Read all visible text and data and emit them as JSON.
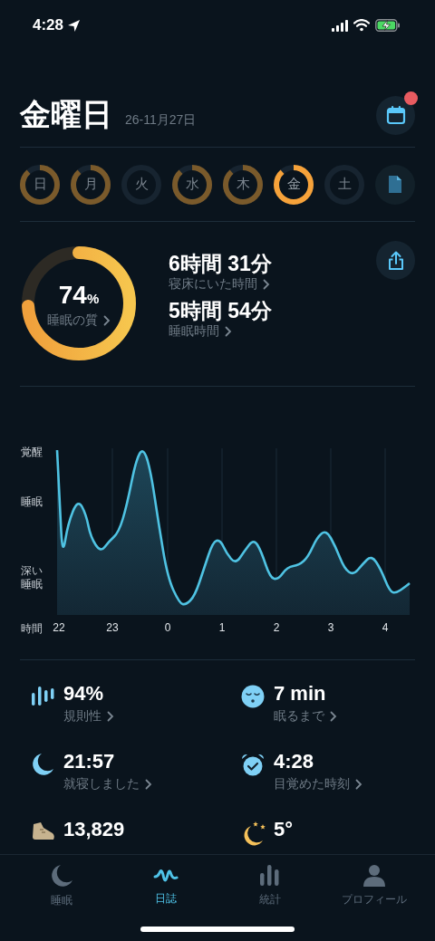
{
  "status_bar": {
    "time": "4:28"
  },
  "header": {
    "title": "金曜日",
    "date": "26-11月27日",
    "calendar_notification": true
  },
  "days": [
    {
      "label": "日",
      "kind": "recorded",
      "selected": false
    },
    {
      "label": "月",
      "kind": "recorded",
      "selected": false
    },
    {
      "label": "火",
      "kind": "empty",
      "selected": false
    },
    {
      "label": "水",
      "kind": "recorded",
      "selected": false
    },
    {
      "label": "木",
      "kind": "recorded",
      "selected": false
    },
    {
      "label": "金",
      "kind": "recorded",
      "selected": true
    },
    {
      "label": "土",
      "kind": "empty",
      "selected": false
    }
  ],
  "summary": {
    "quality": {
      "value": "74",
      "unit": "%",
      "label": "睡眠の質"
    },
    "metrics": [
      {
        "value": "6時間 31分",
        "label": "寝床にいた時間"
      },
      {
        "value": "5時間 54分",
        "label": "睡眠時間"
      }
    ]
  },
  "chart": {
    "y_labels": [
      "覚醒",
      "睡眠",
      "深い睡眠"
    ],
    "x_title": "時間",
    "x_labels": [
      "22",
      "23",
      "0",
      "1",
      "2",
      "3",
      "4"
    ]
  },
  "stats": [
    {
      "kind": "regularity",
      "value": "94%",
      "label": "規則性"
    },
    {
      "kind": "fall_asleep",
      "value": "7 min",
      "label": "眠るまで"
    },
    {
      "kind": "bedtime",
      "value": "21:57",
      "label": "就寝しました"
    },
    {
      "kind": "wake",
      "value": "4:28",
      "label": "目覚めた時刻"
    },
    {
      "kind": "steps",
      "value": "13,829"
    },
    {
      "kind": "weather",
      "value": "5°"
    }
  ],
  "tab_bar": [
    {
      "kind": "sleep",
      "label": "睡眠",
      "selected": false
    },
    {
      "kind": "journal",
      "label": "日誌",
      "selected": true
    },
    {
      "kind": "stats",
      "label": "統計",
      "selected": false
    },
    {
      "kind": "profile",
      "label": "プロフィール",
      "selected": false
    }
  ]
}
